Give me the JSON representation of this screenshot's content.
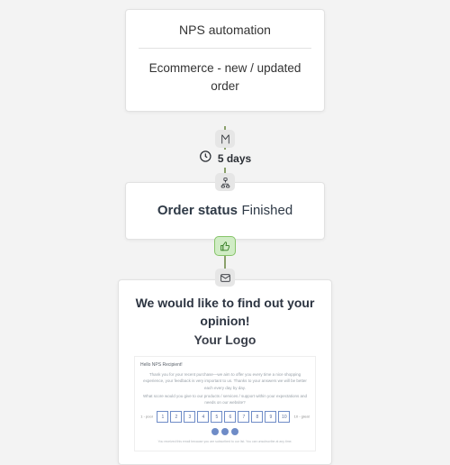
{
  "trigger": {
    "title": "NPS automation",
    "event": "Ecommerce - new / updated order"
  },
  "wait": {
    "label": "5 days"
  },
  "condition": {
    "label": "Order status",
    "value": "Finished"
  },
  "email": {
    "headline": "We would like to find out your opinion!",
    "logo": "Your Logo",
    "greeting": "Hello NPS Recipient!",
    "body1": "Thank you for your recent purchase—we aim to offer you every time a nice shopping experience, your feedback is very important to us. Thanks to your answers we will be better each every day by day.",
    "body2": "What score would you give to our products / services / support within your expectations and needs on our website?",
    "scale_low": "1 - poor",
    "scale_high": "10 - great",
    "scale": [
      "1",
      "2",
      "3",
      "4",
      "5",
      "6",
      "7",
      "8",
      "9",
      "10"
    ],
    "footer": "You received this email because you are subscribed to our list. You can unsubscribe at any time."
  },
  "icons": {
    "flag": "flag-icon",
    "clock": "clock-icon",
    "branch": "branch-icon",
    "thumb": "thumbs-up-icon",
    "mail": "mail-icon"
  }
}
